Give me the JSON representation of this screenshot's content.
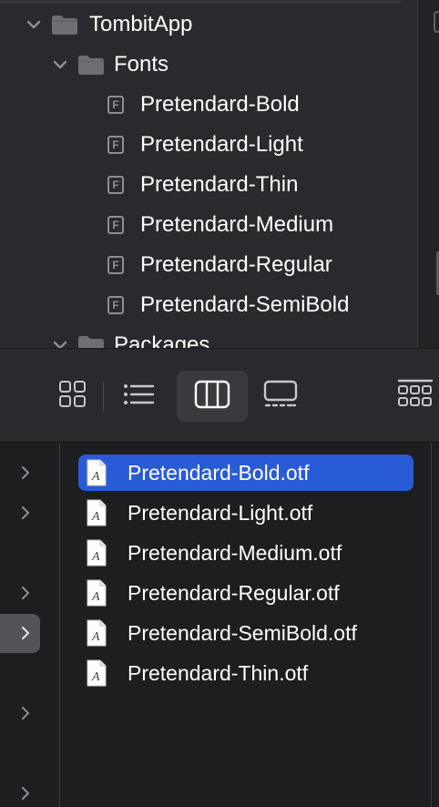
{
  "navigator": {
    "tree": [
      {
        "label": "TombitApp",
        "level": 0,
        "expanded": true,
        "kind": "folder"
      },
      {
        "label": "Fonts",
        "level": 1,
        "expanded": true,
        "kind": "folder"
      },
      {
        "label": "Pretendard-Bold",
        "level": 2,
        "kind": "font-file"
      },
      {
        "label": "Pretendard-Light",
        "level": 2,
        "kind": "font-file"
      },
      {
        "label": "Pretendard-Thin",
        "level": 2,
        "kind": "font-file"
      },
      {
        "label": "Pretendard-Medium",
        "level": 2,
        "kind": "font-file"
      },
      {
        "label": "Pretendard-Regular",
        "level": 2,
        "kind": "font-file"
      },
      {
        "label": "Pretendard-SemiBold",
        "level": 2,
        "kind": "font-file"
      },
      {
        "label": "Packages",
        "level": 1,
        "expanded": true,
        "kind": "folder"
      }
    ],
    "file_icon_letter": "F"
  },
  "toolbar": {
    "views": [
      {
        "name": "icon-view",
        "selected": false
      },
      {
        "name": "list-view",
        "selected": false
      },
      {
        "name": "column-view",
        "selected": true
      },
      {
        "name": "gallery-view",
        "selected": false
      },
      {
        "name": "group-view",
        "selected": false
      }
    ]
  },
  "browser": {
    "files": [
      {
        "label": "Pretendard-Bold.otf",
        "selected": true
      },
      {
        "label": "Pretendard-Light.otf",
        "selected": false
      },
      {
        "label": "Pretendard-Medium.otf",
        "selected": false
      },
      {
        "label": "Pretendard-Regular.otf",
        "selected": false
      },
      {
        "label": "Pretendard-SemiBold.otf",
        "selected": false
      },
      {
        "label": "Pretendard-Thin.otf",
        "selected": false
      }
    ],
    "file_icon_letter": "A"
  },
  "colors": {
    "selection": "#2a5bd7",
    "background": "#1e1e20",
    "panel": "#2a2a2e"
  }
}
